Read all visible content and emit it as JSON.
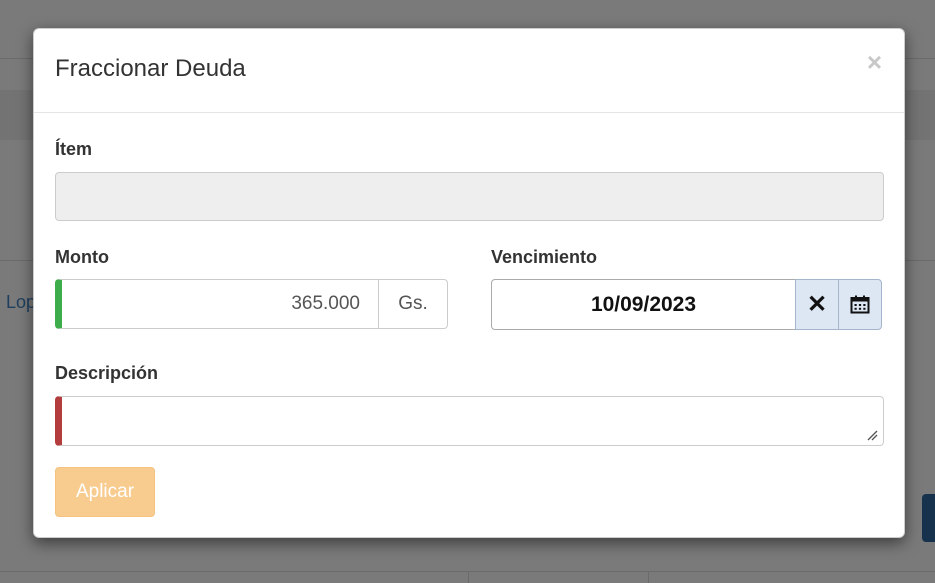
{
  "modal": {
    "title": "Fraccionar Deuda",
    "close_symbol": "×"
  },
  "form": {
    "item": {
      "label": "Ítem",
      "value": ""
    },
    "monto": {
      "label": "Monto",
      "value": "365.000",
      "currency": "Gs."
    },
    "vencimiento": {
      "label": "Vencimiento",
      "value": "10/09/2023",
      "clear_symbol": "✕"
    },
    "descripcion": {
      "label": "Descripción",
      "value": ""
    },
    "apply_label": "Aplicar"
  },
  "background": {
    "link_text": "Lop"
  },
  "colors": {
    "valid_border": "#3cad4a",
    "invalid_border": "#b33c3c",
    "apply_button": "#f8cc8f"
  }
}
